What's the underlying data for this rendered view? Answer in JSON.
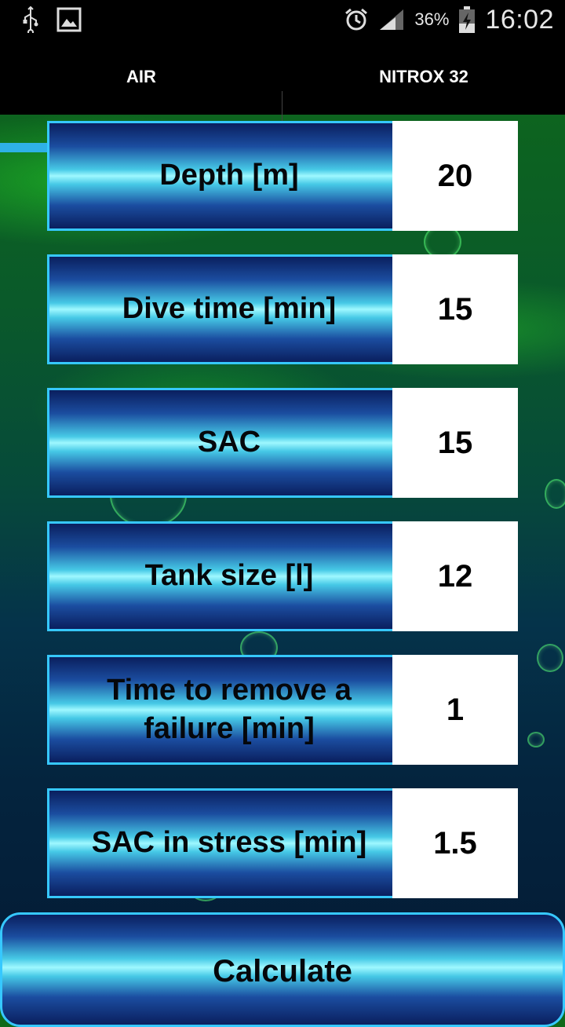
{
  "status_bar": {
    "battery_percent": "36%",
    "time": "16:02"
  },
  "tabs": [
    {
      "label": "AIR",
      "selected": true
    },
    {
      "label": "NITROX 32",
      "selected": false
    }
  ],
  "inputs": [
    {
      "label": "Depth [m]",
      "value": "20"
    },
    {
      "label": "Dive time [min]",
      "value": "15"
    },
    {
      "label": "SAC",
      "value": "15"
    },
    {
      "label": "Tank size [l]",
      "value": "12"
    },
    {
      "label": "Time to remove a failure [min]",
      "value": "1"
    },
    {
      "label": "SAC in stress [min]",
      "value": "1.5"
    }
  ],
  "calculate_label": "Calculate",
  "colors": {
    "accent": "#2fb1e6",
    "button_border": "#36c8ff"
  }
}
